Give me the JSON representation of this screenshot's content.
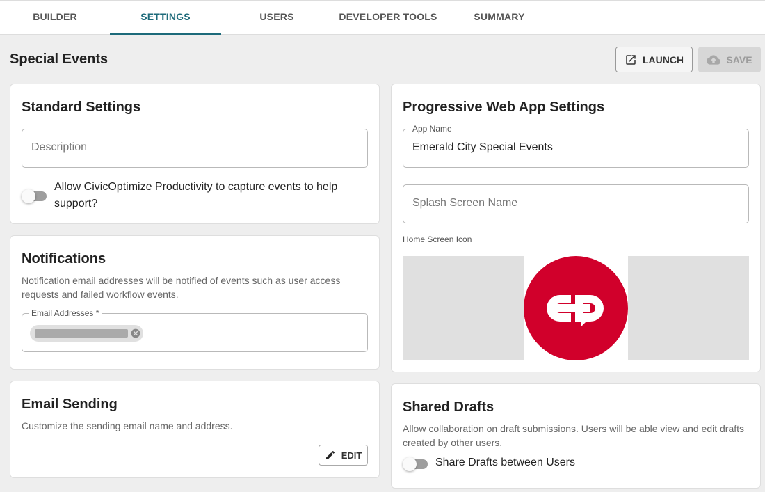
{
  "tabs": [
    {
      "label": "BUILDER"
    },
    {
      "label": "SETTINGS",
      "active": true
    },
    {
      "label": "USERS"
    },
    {
      "label": "DEVELOPER TOOLS"
    },
    {
      "label": "SUMMARY"
    }
  ],
  "header": {
    "title": "Special Events",
    "launch_label": "LAUNCH",
    "save_label": "SAVE"
  },
  "standard_settings": {
    "title": "Standard Settings",
    "description_placeholder": "Description",
    "capture_events_label": "Allow CivicOptimize Productivity to capture events to help support?",
    "capture_events_enabled": false
  },
  "notifications": {
    "title": "Notifications",
    "description": "Notification email addresses will be notified of events such as user access requests and failed workflow events.",
    "email_label": "Email Addresses *"
  },
  "email_sending": {
    "title": "Email Sending",
    "description": "Customize the sending email name and address.",
    "edit_label": "EDIT"
  },
  "pwa_settings": {
    "title": "Progressive Web App Settings",
    "app_name_label": "App Name",
    "app_name_value": "Emerald City Special Events",
    "splash_placeholder": "Splash Screen Name",
    "home_icon_label": "Home Screen Icon",
    "icon_color": "#d1002b"
  },
  "shared_drafts": {
    "title": "Shared Drafts",
    "description": "Allow collaboration on draft submissions. Users will be able view and edit drafts created by other users.",
    "toggle_label": "Share Drafts between Users",
    "enabled": false
  },
  "colors": {
    "accent": "#1d6a7a",
    "background": "#eeeeee"
  }
}
